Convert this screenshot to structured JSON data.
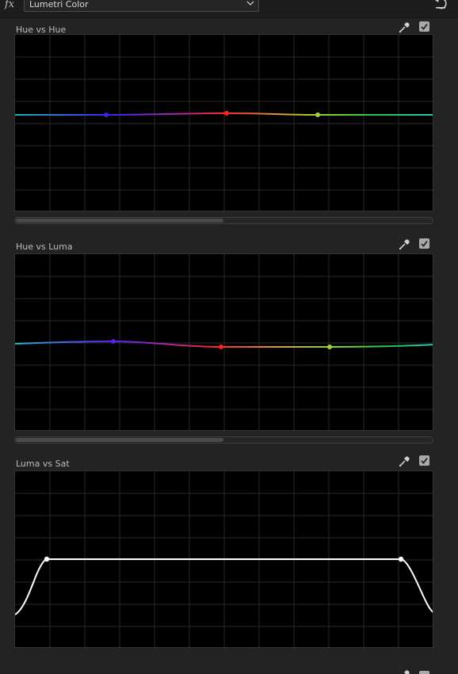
{
  "header": {
    "fx_label": "fx",
    "effect_name": "Lumetri Color",
    "reset_icon": "reset-icon",
    "dropdown_icon": "chevron-down-icon"
  },
  "sections": [
    {
      "title": "Hue vs Hue",
      "icons": [
        "eyedropper-icon",
        "checkbox-checked-icon"
      ],
      "enabled": true,
      "has_scrollbar": true,
      "curve": "flat hue curve with three control points",
      "points": [
        "blue-violet",
        "red",
        "yellow-green"
      ]
    },
    {
      "title": "Hue vs Luma",
      "icons": [
        "eyedropper-icon",
        "checkbox-checked-icon"
      ],
      "enabled": true,
      "has_scrollbar": true,
      "curve": "near-flat hue curve with three control points",
      "points": [
        "violet",
        "red",
        "yellow-green"
      ]
    },
    {
      "title": "Luma vs Sat",
      "icons": [
        "eyedropper-icon",
        "checkbox-checked-icon"
      ],
      "enabled": true,
      "has_scrollbar": false,
      "curve": "white curve with plateau between two control points"
    }
  ],
  "colors": {
    "panel_bg": "#232323",
    "graph_bg": "#000000",
    "grid": "#2a2a2a",
    "checkbox": "#a9a9a9",
    "curve_white": "#ffffff"
  }
}
